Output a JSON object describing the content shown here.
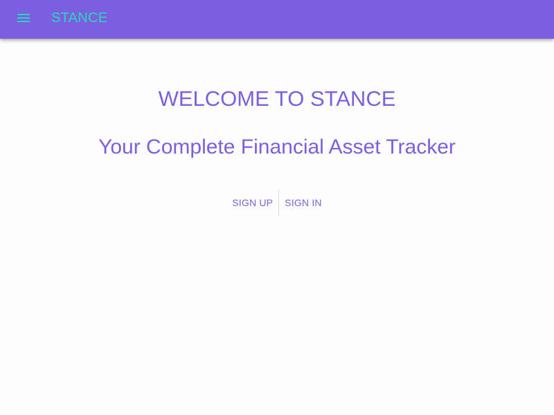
{
  "appbar": {
    "menu_icon": "hamburger-menu-icon",
    "brand": "STANCE",
    "background_color": "#7b5fe0",
    "brand_color": "#26d9b8"
  },
  "hero": {
    "welcome": "WELCOME TO STANCE",
    "tagline": "Your Complete Financial Asset Tracker",
    "text_color": "#7b5fe0"
  },
  "auth": {
    "sign_up_label": "SIGN UP",
    "sign_in_label": "SIGN IN"
  }
}
